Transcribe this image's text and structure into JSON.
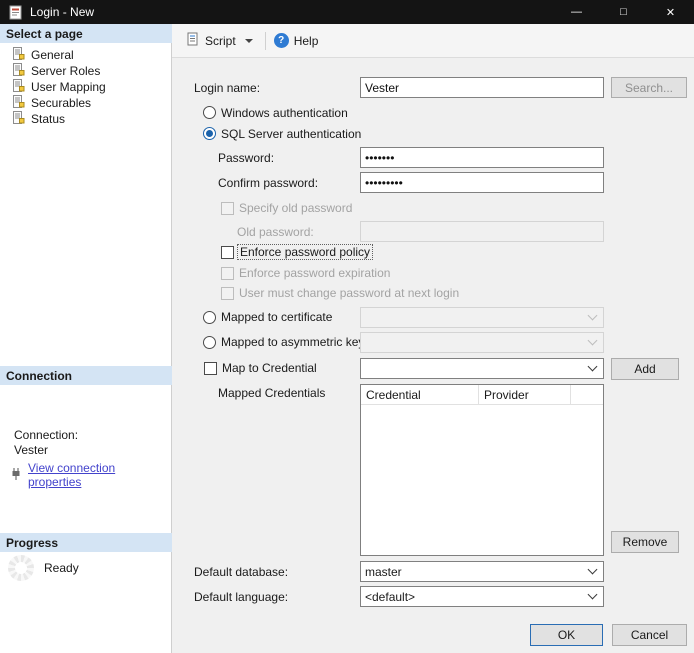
{
  "window": {
    "title": "Login - New",
    "controls": {
      "minimize": "—",
      "maximize": "□",
      "close": "✕"
    }
  },
  "sidebar": {
    "select_page_header": "Select a page",
    "pages": [
      {
        "label": "General"
      },
      {
        "label": "Server Roles"
      },
      {
        "label": "User Mapping"
      },
      {
        "label": "Securables"
      },
      {
        "label": "Status"
      }
    ],
    "connection_header": "Connection",
    "connection_label": "Connection:",
    "connection_value": "Vester",
    "view_link": "View connection properties",
    "progress_header": "Progress",
    "progress_status": "Ready"
  },
  "toolbar": {
    "script_label": "Script",
    "help_label": "Help",
    "help_icon_glyph": "?"
  },
  "form": {
    "login_name_label": "Login name:",
    "login_name_value": "Vester",
    "search_button": "Search...",
    "windows_auth_label": "Windows authentication",
    "sql_auth_label": "SQL Server authentication",
    "password_label": "Password:",
    "password_value": "•••••••",
    "confirm_password_label": "Confirm password:",
    "confirm_password_value": "•••••••••",
    "specify_old_password_label": "Specify old password",
    "old_password_label": "Old password:",
    "old_password_value": "",
    "enforce_policy_label": "Enforce password policy",
    "enforce_expiration_label": "Enforce password expiration",
    "must_change_label": "User must change password at next login",
    "mapped_certificate_label": "Mapped to certificate",
    "mapped_certificate_value": "",
    "mapped_asymmetric_label": "Mapped to asymmetric key",
    "mapped_asymmetric_value": "",
    "map_credential_label": "Map to Credential",
    "map_credential_value": "",
    "add_button": "Add",
    "mapped_credentials_label": "Mapped Credentials",
    "credentials_table": {
      "headers": [
        "Credential",
        "Provider"
      ],
      "rows": []
    },
    "remove_button": "Remove",
    "default_database_label": "Default database:",
    "default_database_value": "master",
    "default_language_label": "Default language:",
    "default_language_value": "<default>"
  },
  "footer": {
    "ok_button": "OK",
    "cancel_button": "Cancel"
  }
}
